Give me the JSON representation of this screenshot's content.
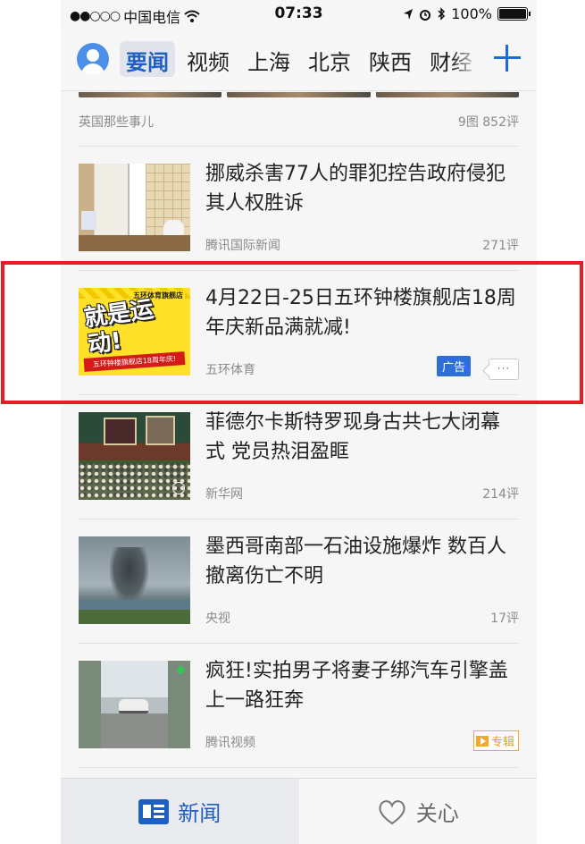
{
  "status_bar": {
    "carrier": "中国电信",
    "signal": "●●○○○",
    "time": "07:33",
    "battery": "100%",
    "battery_level": 1.0
  },
  "top_nav": {
    "tabs": [
      {
        "label": "要闻",
        "active": true
      },
      {
        "label": "视频",
        "active": false
      },
      {
        "label": "上海",
        "active": false
      },
      {
        "label": "北京",
        "active": false
      },
      {
        "label": "陕西",
        "active": false
      },
      {
        "label": "财经",
        "active": false
      }
    ],
    "icons": [
      "user-avatar-icon",
      "plus-icon"
    ]
  },
  "previous_item": {
    "source": "英国那些事儿",
    "count": "9图  852评"
  },
  "feed": [
    {
      "title": "挪威杀害77人的罪犯控告政府侵犯其人权胜诉",
      "source": "腾讯国际新闻",
      "comments": "271评",
      "thumb": "room"
    },
    {
      "title": "4月22日-25日五环钟楼旗舰店18周年庆新品满就减!",
      "source": "五环体育",
      "ad_label": "广告",
      "more_label": "···",
      "thumb": "ad",
      "thumb_text": {
        "logo": "五环体育旗舰店",
        "big": "就是运动!",
        "banner": "五环钟楼旗舰店18周年庆!"
      }
    },
    {
      "title": "菲德尔卡斯特罗现身古共七大闭幕式 党员热泪盈眶",
      "source": "新华网",
      "comments": "214评",
      "thumb": "hall"
    },
    {
      "title": "墨西哥南部一石油设施爆炸 数百人撤离伤亡不明",
      "source": "央视",
      "comments": "17评",
      "thumb": "smoke"
    },
    {
      "title": "疯狂!实拍男子将妻子绑汽车引擎盖上一路狂奔",
      "source": "腾讯视频",
      "special_label": "专辑",
      "thumb": "car"
    }
  ],
  "bottom_bar": {
    "news_label": "新闻",
    "follow_label": "关心"
  },
  "colors": {
    "accent": "#1e5fc6",
    "ad_badge": "#2e6fd6",
    "highlight": "#e81c24",
    "special": "#f0a830"
  }
}
